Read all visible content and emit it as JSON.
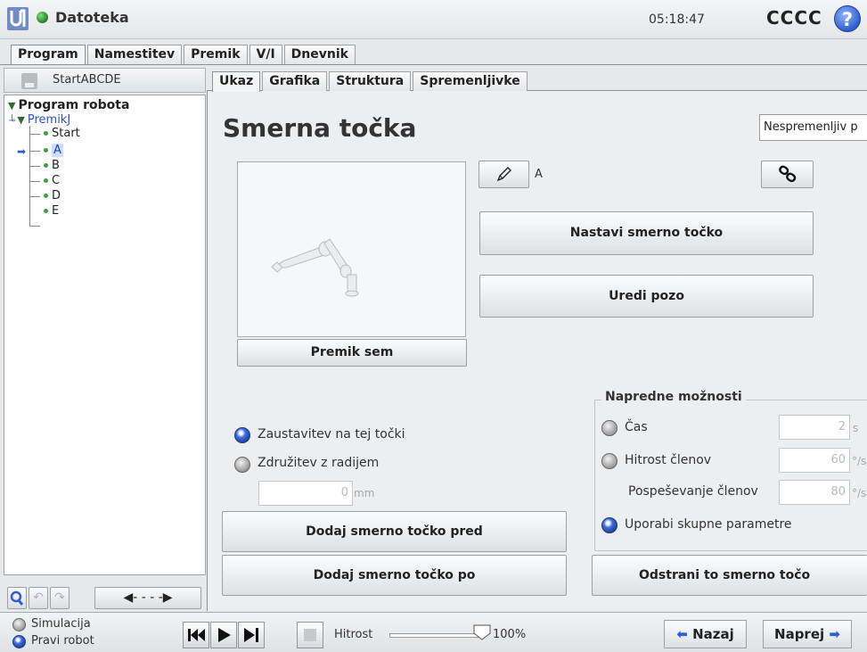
{
  "header": {
    "file_menu": "Datoteka",
    "time": "05:18:47",
    "robot_name": "CCCC",
    "help": "?"
  },
  "main_tabs": [
    "Program",
    "Namestitev",
    "Premik",
    "V/I",
    "Dnevnik"
  ],
  "program": {
    "name": "StartABCDE",
    "tree": {
      "root": "Program robota",
      "move": "PremikJ",
      "items": [
        "Start",
        "A",
        "B",
        "C",
        "D",
        "E"
      ]
    }
  },
  "command_tabs": [
    "Ukaz",
    "Grafika",
    "Struktura",
    "Spremenljivke"
  ],
  "waypoint": {
    "title": "Smerna točka",
    "dropdown_value": "Nespremenljiv p",
    "name": "A",
    "move_here": "Premik sem",
    "set_waypoint": "Nastavi smerno točko",
    "edit_pose": "Uredi pozo",
    "stop_here": "Zaustavitev na tej točki",
    "blend_radius": "Združitev z radijem",
    "blend_value": "0",
    "blend_unit": "mm",
    "add_before": "Dodaj smerno točko pred",
    "add_after": "Dodaj smerno točko po",
    "remove": "Odstrani to smerno točo"
  },
  "advanced": {
    "title": "Napredne možnosti",
    "time_label": "Čas",
    "time_value": "2",
    "time_unit": "s",
    "joint_speed_label": "Hitrost členov",
    "joint_speed_value": "60",
    "joint_speed_unit": "°/s",
    "joint_accel_label": "Pospeševanje členov",
    "joint_accel_value": "80",
    "joint_accel_unit": "°/s",
    "shared_params": "Uporabi skupne parametre"
  },
  "footer": {
    "simulation": "Simulacija",
    "real_robot": "Pravi robot",
    "speed_label": "Hitrost",
    "speed_value": "100%",
    "speed_fraction": 1.0,
    "back": "Nazaj",
    "next": "Naprej"
  },
  "colors": {
    "accent_blue": "#2d5fd0",
    "status_green": "#2c8a2c"
  }
}
